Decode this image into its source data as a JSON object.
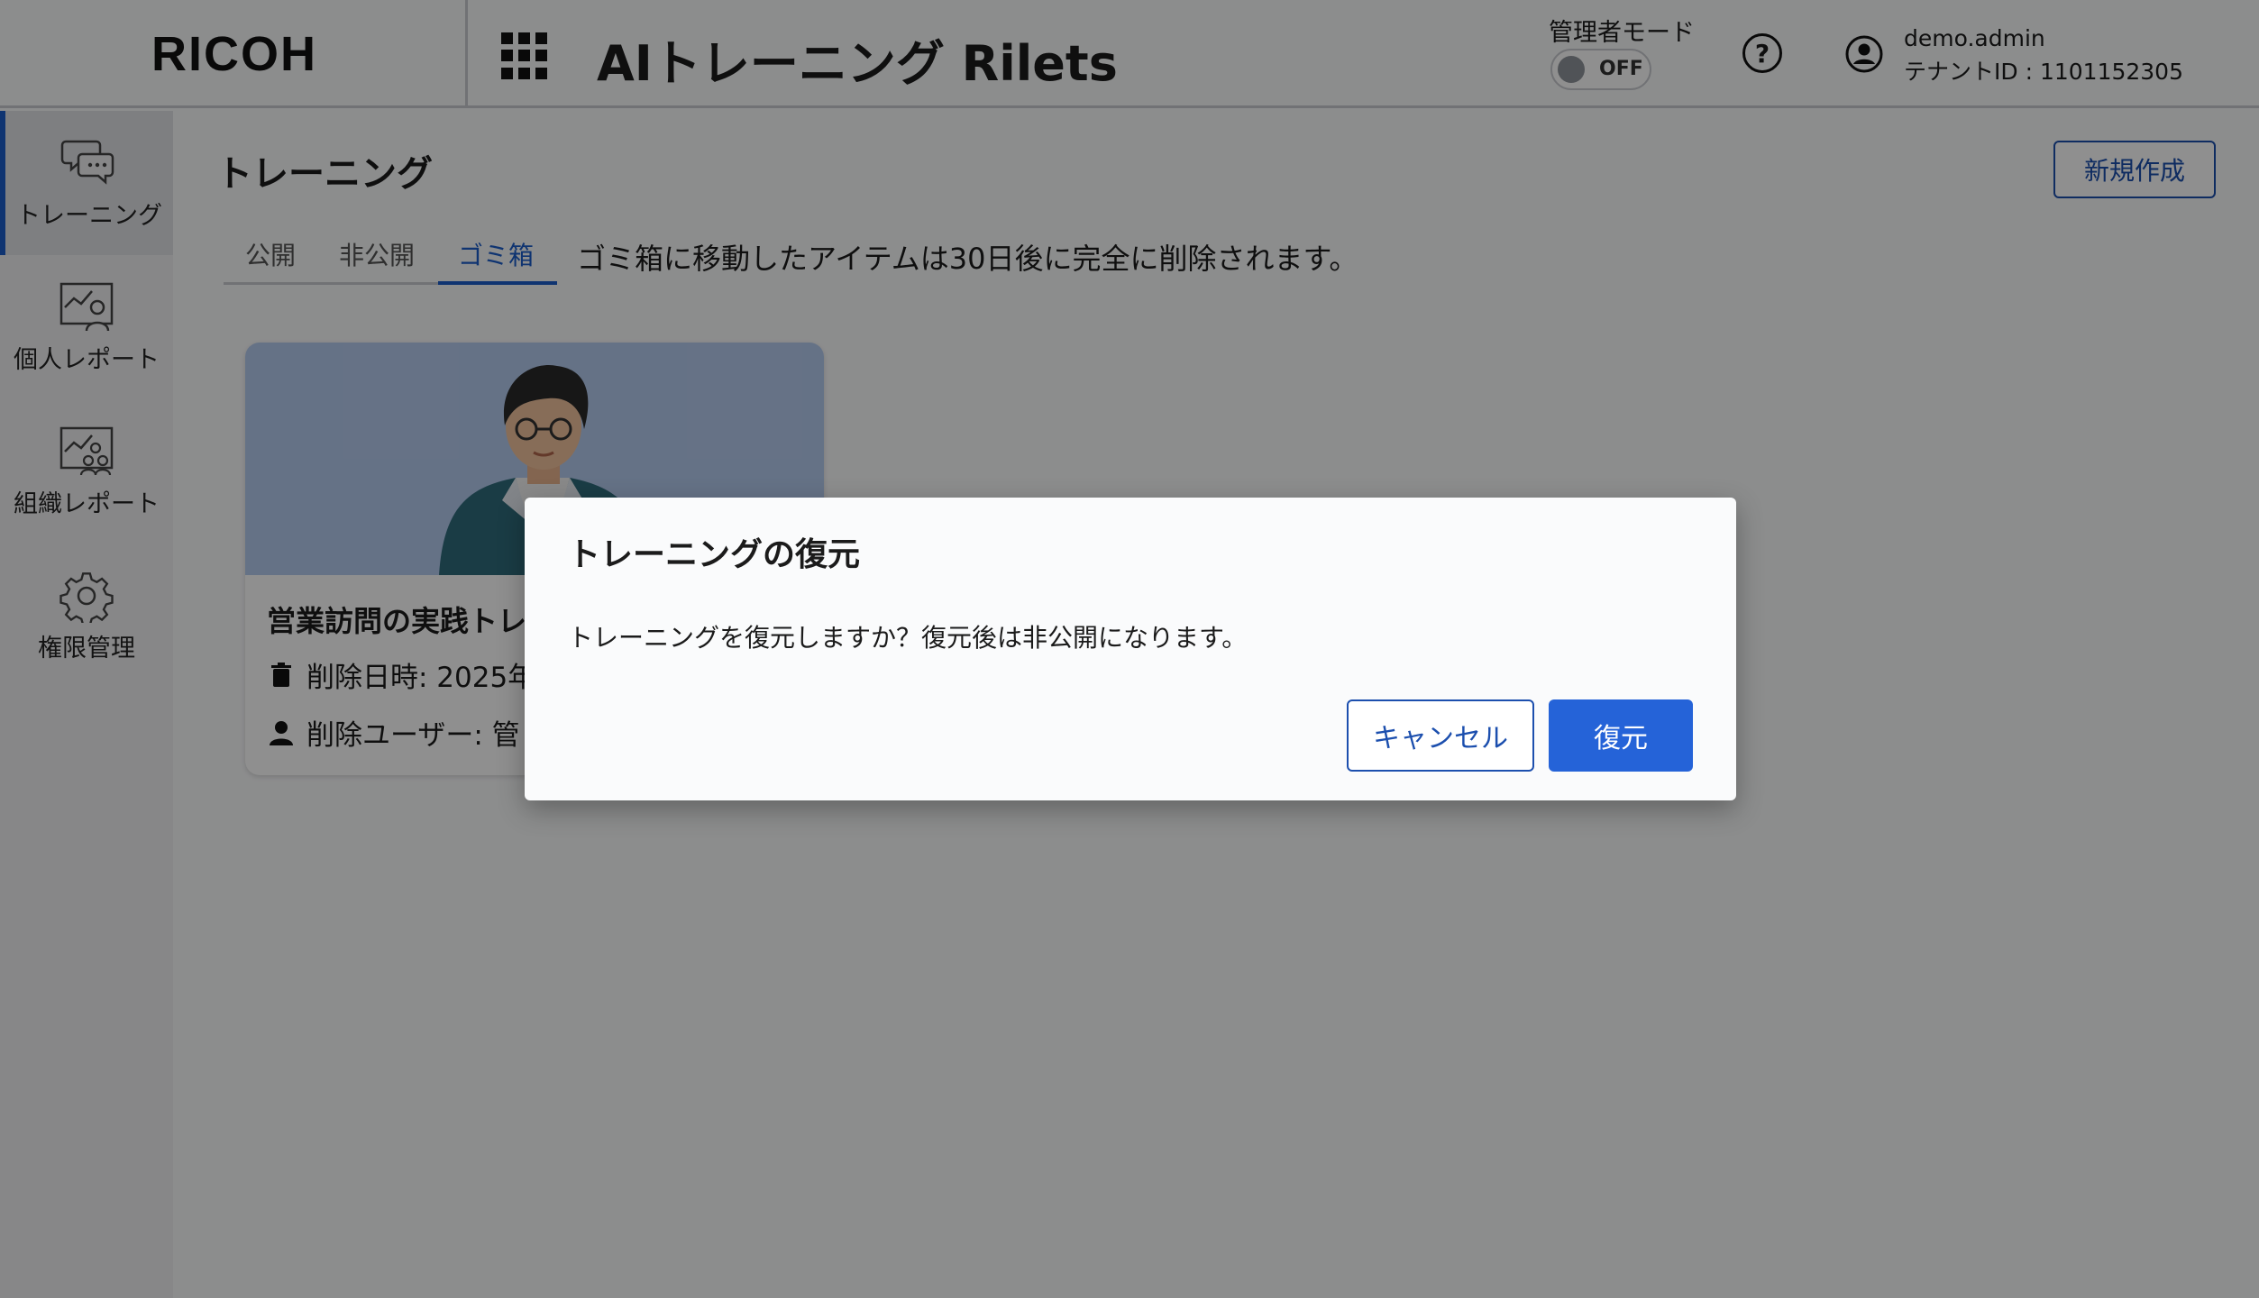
{
  "header": {
    "logo": "RICOH",
    "app_title": "AIトレーニング Rilets",
    "admin_mode_label": "管理者モード",
    "admin_toggle": "OFF",
    "help_glyph": "?",
    "user_name": "demo.admin",
    "tenant_id": "テナントID : 1101152305"
  },
  "sidebar": {
    "items": [
      {
        "label": "トレーニング",
        "icon": "chat-bubbles-icon",
        "active": true
      },
      {
        "label": "個人レポート",
        "icon": "personal-report-icon"
      },
      {
        "label": "組織レポート",
        "icon": "organization-report-icon"
      },
      {
        "label": "権限管理",
        "icon": "gear-icon"
      }
    ]
  },
  "main": {
    "title": "トレーニング",
    "new_button": "新規作成",
    "tabs": [
      {
        "label": "公開"
      },
      {
        "label": "非公開"
      },
      {
        "label": "ゴミ箱",
        "active": true
      }
    ],
    "trash_note": "ゴミ箱に移動したアイテムは30日後に完全に削除されます。",
    "card": {
      "title": "営業訪問の実践トレ",
      "deleted_at": "削除日時: 2025年",
      "deleted_by": "削除ユーザー: 管"
    }
  },
  "dialog": {
    "title": "トレーニングの復元",
    "message": "トレーニングを復元しますか？復元後は非公開になります。",
    "cancel": "キャンセル",
    "confirm": "復元"
  },
  "colors": {
    "accent": "#1c5ec9",
    "primary_button": "#2563d8",
    "card_image_bg": "#b5cbef"
  }
}
